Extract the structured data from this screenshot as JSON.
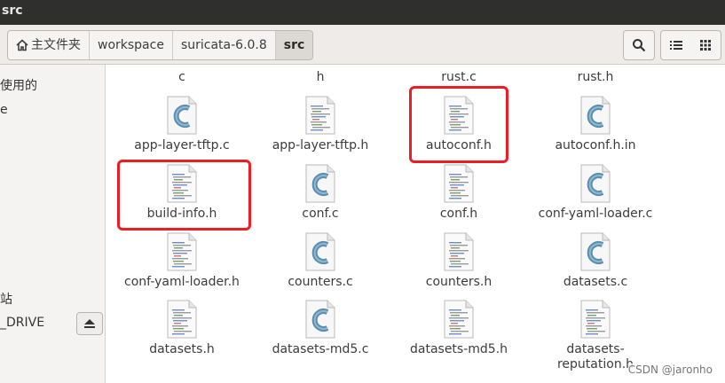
{
  "window": {
    "title": "src"
  },
  "breadcrumb": [
    "主文件夹",
    "workspace",
    "suricata-6.0.8",
    "src"
  ],
  "toolbar": {
    "search_icon": "search-icon",
    "list_icon": "list-view-icon",
    "grid_icon": "grid-view-icon"
  },
  "sidebar": {
    "items": [
      "使用的",
      "e",
      "站",
      "_DRIVE"
    ]
  },
  "files_partial": [
    {
      "line2": "c"
    },
    {
      "line2": "h"
    },
    {
      "line2": "rust.c"
    },
    {
      "line2": "rust.h"
    }
  ],
  "files": [
    {
      "name": "app-layer-tftp.c",
      "type": "c"
    },
    {
      "name": "app-layer-tftp.h",
      "type": "h"
    },
    {
      "name": "autoconf.h",
      "type": "h"
    },
    {
      "name": "autoconf.h.in",
      "type": "c"
    },
    {
      "name": "build-info.h",
      "type": "h"
    },
    {
      "name": "conf.c",
      "type": "c"
    },
    {
      "name": "conf.h",
      "type": "h"
    },
    {
      "name": "conf-yaml-loader.c",
      "type": "c"
    },
    {
      "name": "conf-yaml-loader.h",
      "type": "h"
    },
    {
      "name": "counters.c",
      "type": "c"
    },
    {
      "name": "counters.h",
      "type": "h"
    },
    {
      "name": "datasets.c",
      "type": "c"
    },
    {
      "name": "datasets.h",
      "type": "h"
    },
    {
      "name": "datasets-md5.c",
      "type": "c"
    },
    {
      "name": "datasets-md5.h",
      "type": "h"
    },
    {
      "name": "datasets-\nreputation.h",
      "type": "h"
    }
  ],
  "watermark": "CSDN @jaronho",
  "colors": {
    "highlight": "#ee1d23",
    "titlebar": "#2f2f2d"
  }
}
